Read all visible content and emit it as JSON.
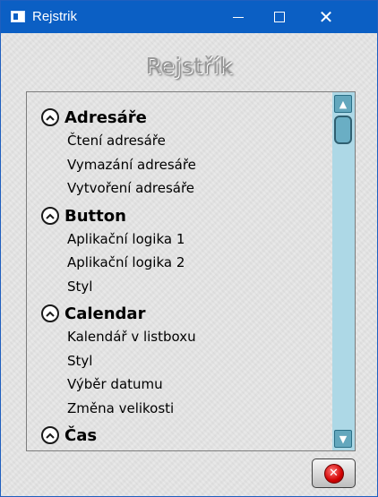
{
  "window": {
    "title": "Rejstrik"
  },
  "titlebar_icons": {
    "app": "window-icon",
    "minimize": "minimize-icon",
    "maximize": "maximize-icon",
    "close": "close-icon"
  },
  "heading": "Rejstřík",
  "groups": [
    {
      "title": "Adresáře",
      "items": [
        "Čtení adresáře",
        "Vymazání adresáře",
        "Vytvoření adresáře"
      ]
    },
    {
      "title": "Button",
      "items": [
        "Aplikační logika 1",
        "Aplikační logika 2",
        "Styl"
      ]
    },
    {
      "title": "Calendar",
      "items": [
        "Kalendář v listboxu",
        "Styl",
        "Výběr datumu",
        "Změna velikosti"
      ]
    },
    {
      "title": "Čas",
      "items": []
    }
  ],
  "scrollbar": {
    "up_glyph": "▲",
    "down_glyph": "▼"
  },
  "close_button_glyph": "✕",
  "colors": {
    "titlebar": "#0b5fc4",
    "scrollbar_track": "#add8e6",
    "cancel_icon": "#d10000"
  }
}
